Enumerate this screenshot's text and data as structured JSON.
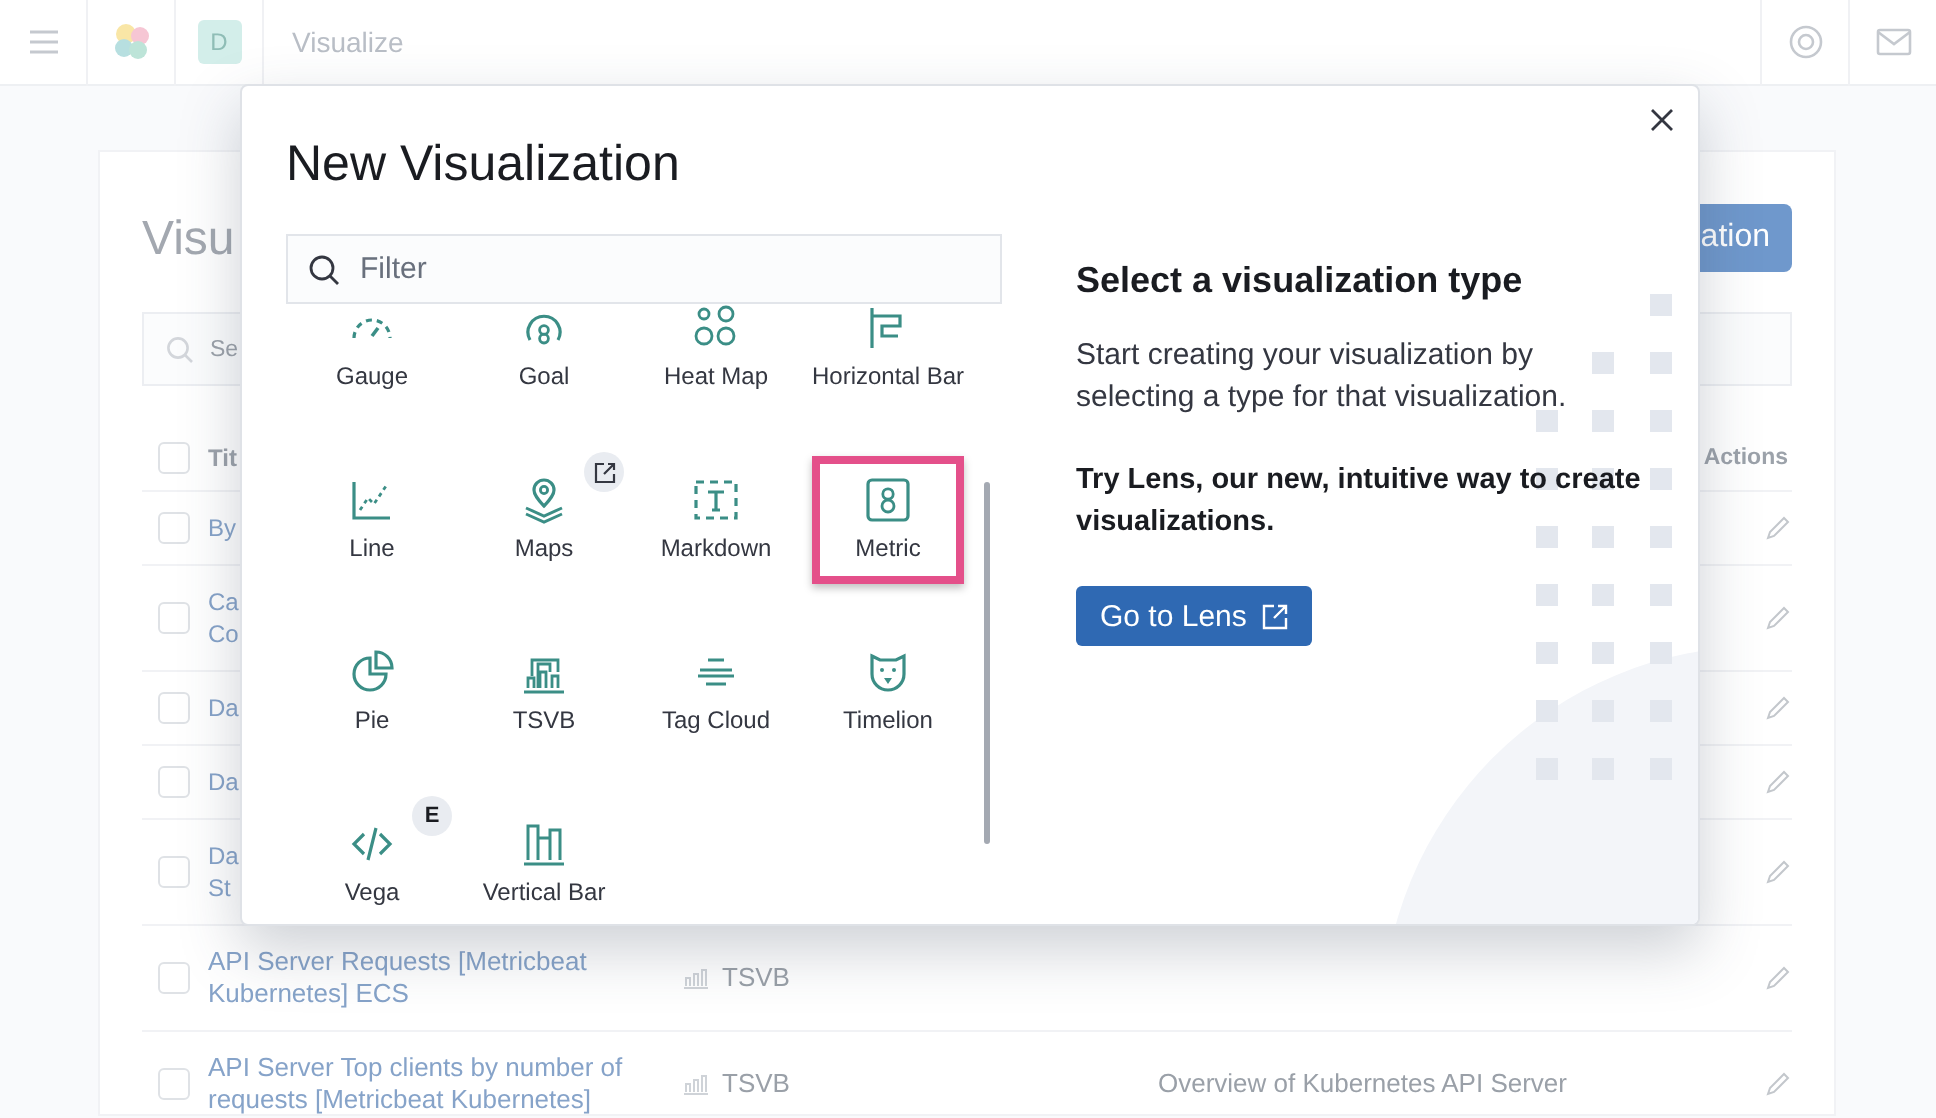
{
  "header": {
    "space_avatar": "D",
    "breadcrumb": "Visualize"
  },
  "background": {
    "title": "Visu",
    "search_placeholder": "Se",
    "create_button": "ation",
    "select_all": {
      "checked": false
    },
    "columns": [
      {
        "label": "Tit"
      },
      {
        "label": "Actions"
      }
    ],
    "rows": [
      {
        "title": "By",
        "checked": false
      },
      {
        "title": "Ca Co",
        "checked": false
      },
      {
        "title": "Da",
        "checked": false
      },
      {
        "title": "Da",
        "checked": false
      },
      {
        "title": "Da St",
        "checked": false
      },
      {
        "title": "API Server Requests [Metricbeat Kubernetes] ECS",
        "type": "TSVB",
        "checked": false
      },
      {
        "title": "API Server Top clients by number of requests [Metricbeat Kubernetes]",
        "type": "TSVB",
        "description": "Overview of Kubernetes API Server",
        "checked": false
      }
    ]
  },
  "modal": {
    "title": "New Visualization",
    "filter": {
      "placeholder": "Filter"
    },
    "items": [
      {
        "label": "Gauge",
        "selected": false
      },
      {
        "label": "Goal",
        "selected": false
      },
      {
        "label": "Heat Map",
        "selected": false
      },
      {
        "label": "Horizontal Bar",
        "selected": false
      },
      {
        "label": "Line",
        "selected": false
      },
      {
        "label": "Maps",
        "selected": false,
        "badge": {
          "kind": "icon"
        }
      },
      {
        "label": "Markdown",
        "selected": false
      },
      {
        "label": "Metric",
        "selected": true
      },
      {
        "label": "Pie",
        "selected": false
      },
      {
        "label": "TSVB",
        "selected": false
      },
      {
        "label": "Tag Cloud",
        "selected": false
      },
      {
        "label": "Timelion",
        "selected": false
      },
      {
        "label": "Vega",
        "selected": false,
        "badge": {
          "kind": "text",
          "text": "E"
        }
      },
      {
        "label": "Vertical Bar",
        "selected": false
      }
    ],
    "info": {
      "heading": "Select a visualization type",
      "text": "Start creating your visualization by selecting a type for that visualization.",
      "promo": "Try Lens, our new, intuitive way to create visualizations.",
      "button": "Go to Lens"
    }
  }
}
